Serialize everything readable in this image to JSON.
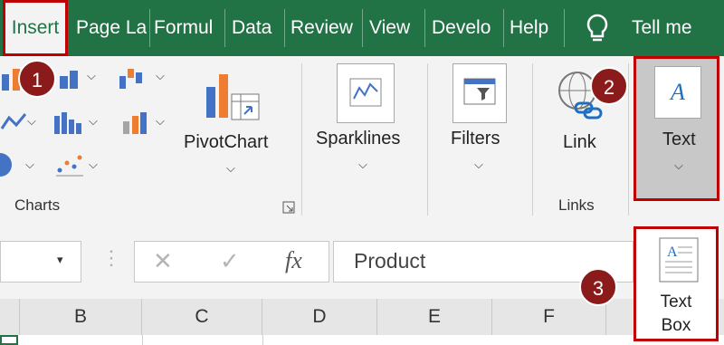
{
  "tabs": [
    {
      "label": "Insert"
    },
    {
      "label": "Page La"
    },
    {
      "label": "Formul"
    },
    {
      "label": "Data"
    },
    {
      "label": "Review"
    },
    {
      "label": "View"
    },
    {
      "label": "Develo"
    },
    {
      "label": "Help"
    },
    {
      "label": "Tell me"
    }
  ],
  "ribbon": {
    "charts_group_label": "Charts",
    "pivotchart_label": "PivotChart",
    "sparklines_label": "Sparklines",
    "filters_label": "Filters",
    "link_label": "Link",
    "links_group_label": "Links",
    "text_label": "Text"
  },
  "formula_bar": {
    "cancel_glyph": "✕",
    "enter_glyph": "✓",
    "fx_glyph": "fx",
    "content": "Product"
  },
  "columns": [
    "B",
    "C",
    "D",
    "E",
    "F"
  ],
  "textbox_popup": {
    "line1": "Text",
    "line2": "Box"
  },
  "badges": [
    "1",
    "2",
    "3"
  ],
  "colors": {
    "excel_green": "#217346",
    "highlight_red": "#c00000",
    "badge": "#8b1b1b"
  },
  "icons": [
    "lightbulb-icon",
    "pivotchart-icon",
    "sparkline-icon",
    "filter-icon",
    "link-icon",
    "text-icon",
    "textbox-icon"
  ]
}
